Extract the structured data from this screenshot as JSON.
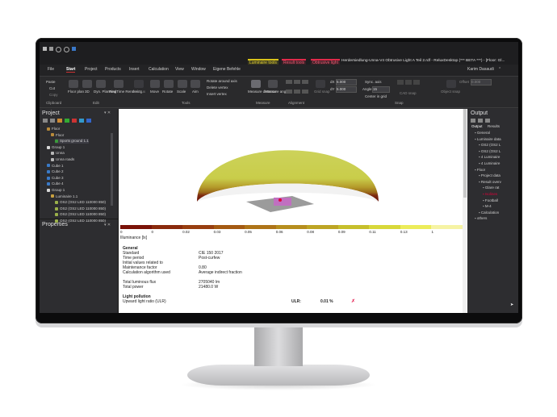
{
  "window": {
    "title": "Herdersiedlung-Unna-V4 Obtrusive Light A Teil 2.rdf - ReluxDesktop (*** BETA ***) - [Floor: Gl...",
    "context_tabs": [
      "Luminaire tools",
      "Result tools",
      "Obtrusive light"
    ],
    "user": "Karim Dasaudi"
  },
  "menu": [
    "File",
    "Start",
    "Project",
    "Products",
    "Insert",
    "Calculation",
    "View",
    "Window",
    "Eigene Befehle"
  ],
  "ribbon": {
    "clipboard": {
      "group": "Clipboard",
      "paste": "Paste",
      "cut": "Cut",
      "copy": "Copy"
    },
    "edit": {
      "group": "Edit",
      "floor_plan": "Floor plan",
      "view_3d": "3D",
      "dyn_planning": "Dyn. Planning",
      "realtime_rendering": "RealTime Rendering",
      "fastlux": "FastLux"
    },
    "tools": {
      "group": "Tools",
      "move": "Move",
      "rotate": "Rotate",
      "scale": "Scale",
      "aim": "Aim",
      "rotate_around_axis": "Rotate around axis",
      "delete_vertex": "Delete vertex",
      "insert_vertex": "Insert vertex"
    },
    "measure": {
      "group": "Measure",
      "distance": "Measure distance",
      "angle": "Measure angle"
    },
    "alignment": {
      "group": "Alignment"
    },
    "snap": {
      "group": "Snap",
      "dx_label": "dX",
      "dx_value": "5.000",
      "dy_label": "dY",
      "dy_value": "5.000",
      "sync_axis": "Sync. axis",
      "angle_label": "Angle",
      "angle_value": "15",
      "center_in_grid": "Center in grid",
      "grid_snap": "Grid snap",
      "cad_snap": "CAD snap",
      "object_snap": "Object snap",
      "offset_label": "Offset",
      "offset_value": "0.000"
    }
  },
  "project_panel": {
    "title": "Project",
    "tree": [
      {
        "label": "Floor",
        "indent": 1
      },
      {
        "label": "Floor",
        "indent": 2
      },
      {
        "label": "Sports ground 1.1",
        "indent": 3
      },
      {
        "label": "Group 1",
        "indent": 1
      },
      {
        "label": "Unna",
        "indent": 2
      },
      {
        "label": "Unna roads",
        "indent": 2
      },
      {
        "label": "Cube 1",
        "indent": 1
      },
      {
        "label": "Cube 2",
        "indent": 1
      },
      {
        "label": "Cube 3",
        "indent": 1
      },
      {
        "label": "Cube 4",
        "indent": 1
      },
      {
        "label": "Group 1",
        "indent": 1
      },
      {
        "label": "Luminaire 1.1",
        "indent": 2
      },
      {
        "label": "OS2 (OS2 LED 110000 850)",
        "indent": 3
      },
      {
        "label": "OS2 (OS2 LED 110000 850)",
        "indent": 3
      },
      {
        "label": "OS2 (OS2 LED 110000 850)",
        "indent": 3
      },
      {
        "label": "OS2 (OS2 LED 110000 850)",
        "indent": 3
      }
    ]
  },
  "properties_panel": {
    "title": "Properties"
  },
  "output_panel": {
    "title": "Output",
    "tabs": [
      "Output",
      "Results"
    ],
    "tree": [
      {
        "label": "General",
        "indent": 1
      },
      {
        "label": "Luminaire data",
        "indent": 1
      },
      {
        "label": "OS2 (OS2 L",
        "indent": 2
      },
      {
        "label": "OS2 (OS2 L",
        "indent": 2
      },
      {
        "label": "4 Luminaire",
        "indent": 2
      },
      {
        "label": "4 Luminaire",
        "indent": 2
      },
      {
        "label": "Floor",
        "indent": 1
      },
      {
        "label": "Project data",
        "indent": 2
      },
      {
        "label": "Result overv",
        "indent": 2
      },
      {
        "label": "Glare rat",
        "indent": 3
      },
      {
        "label": "Isolines",
        "indent": 3
      },
      {
        "label": "Football",
        "indent": 3
      },
      {
        "label": "M-4",
        "indent": 3
      },
      {
        "label": "Calculation",
        "indent": 2
      },
      {
        "label": "others",
        "indent": 1
      }
    ]
  },
  "legend": {
    "unit_label": "Illuminance [lx]",
    "ticks": [
      "0",
      "0",
      "0.02",
      "0.03",
      "0.05",
      "0.06",
      "0.08",
      "0.09",
      "0.11",
      "0.13",
      "1"
    ],
    "colors": [
      "#7a1208",
      "#8a2a0c",
      "#983e10",
      "#a45a12",
      "#ae7418",
      "#b68e1e",
      "#bda524",
      "#c6bf2c",
      "#d8d83a",
      "#ecec5a",
      "#f6f3a4"
    ]
  },
  "report": {
    "general_heading": "General",
    "rows": [
      {
        "label": "Standard",
        "value": "CIE 150 2017"
      },
      {
        "label": "Time period",
        "value": "Post-curfew"
      },
      {
        "label": "Initial values related to",
        "value": ""
      },
      {
        "label": "Maintenance factor",
        "value": "0.80"
      },
      {
        "label": "Calculation algorithm used",
        "value": "Average indirect fraction"
      },
      {
        "label": "Total luminous flux",
        "value": "2705040 lm"
      },
      {
        "label": "Total power",
        "value": "21480.0 W"
      }
    ],
    "light_pollution_heading": "Light pollution",
    "ulr_row_label": "Upward light ratio (ULR)",
    "ulr_label": "ULR:",
    "ulr_value": "0.01 %",
    "ulr_status": "✗"
  },
  "colors": {
    "accent_red": "#e0003a",
    "context_luminaire": "#d8c21a",
    "context_result": "#e02a4a",
    "context_obtrusive": "#e02a4a"
  }
}
